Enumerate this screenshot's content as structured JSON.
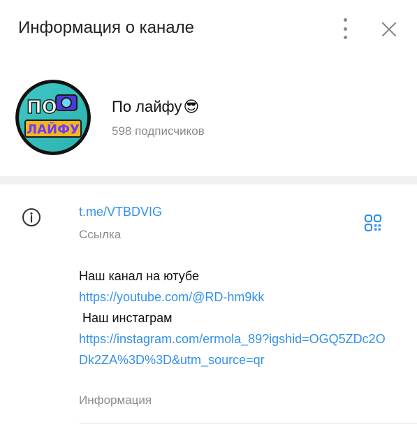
{
  "header": {
    "title": "Информация о канале",
    "menu_icon": "kebab-menu-icon",
    "close_icon": "close-icon"
  },
  "channel": {
    "name": "По лайфу",
    "emoji": "😎",
    "subscribers": "598 подписчиков",
    "avatar_text_top": "ПО",
    "avatar_text_bottom": "ЛАЙФУ"
  },
  "info": {
    "link": "t.me/VTBDVIG",
    "link_label": "Ссылка",
    "description": {
      "line1": "Наш канал на ютубе",
      "youtube_url": "https://youtube.com/@RD-hm9kk",
      "line2": " Наш инстаграм",
      "instagram_url": "https://instagram.com/ermola_89?igshid=OGQ5ZDc2ODk2ZA%3D%3D&utm_source=qr"
    },
    "description_label": "Информация"
  },
  "colors": {
    "accent": "#3390ec",
    "secondary_text": "#8a8a8a",
    "divider": "#f0f0f0"
  }
}
